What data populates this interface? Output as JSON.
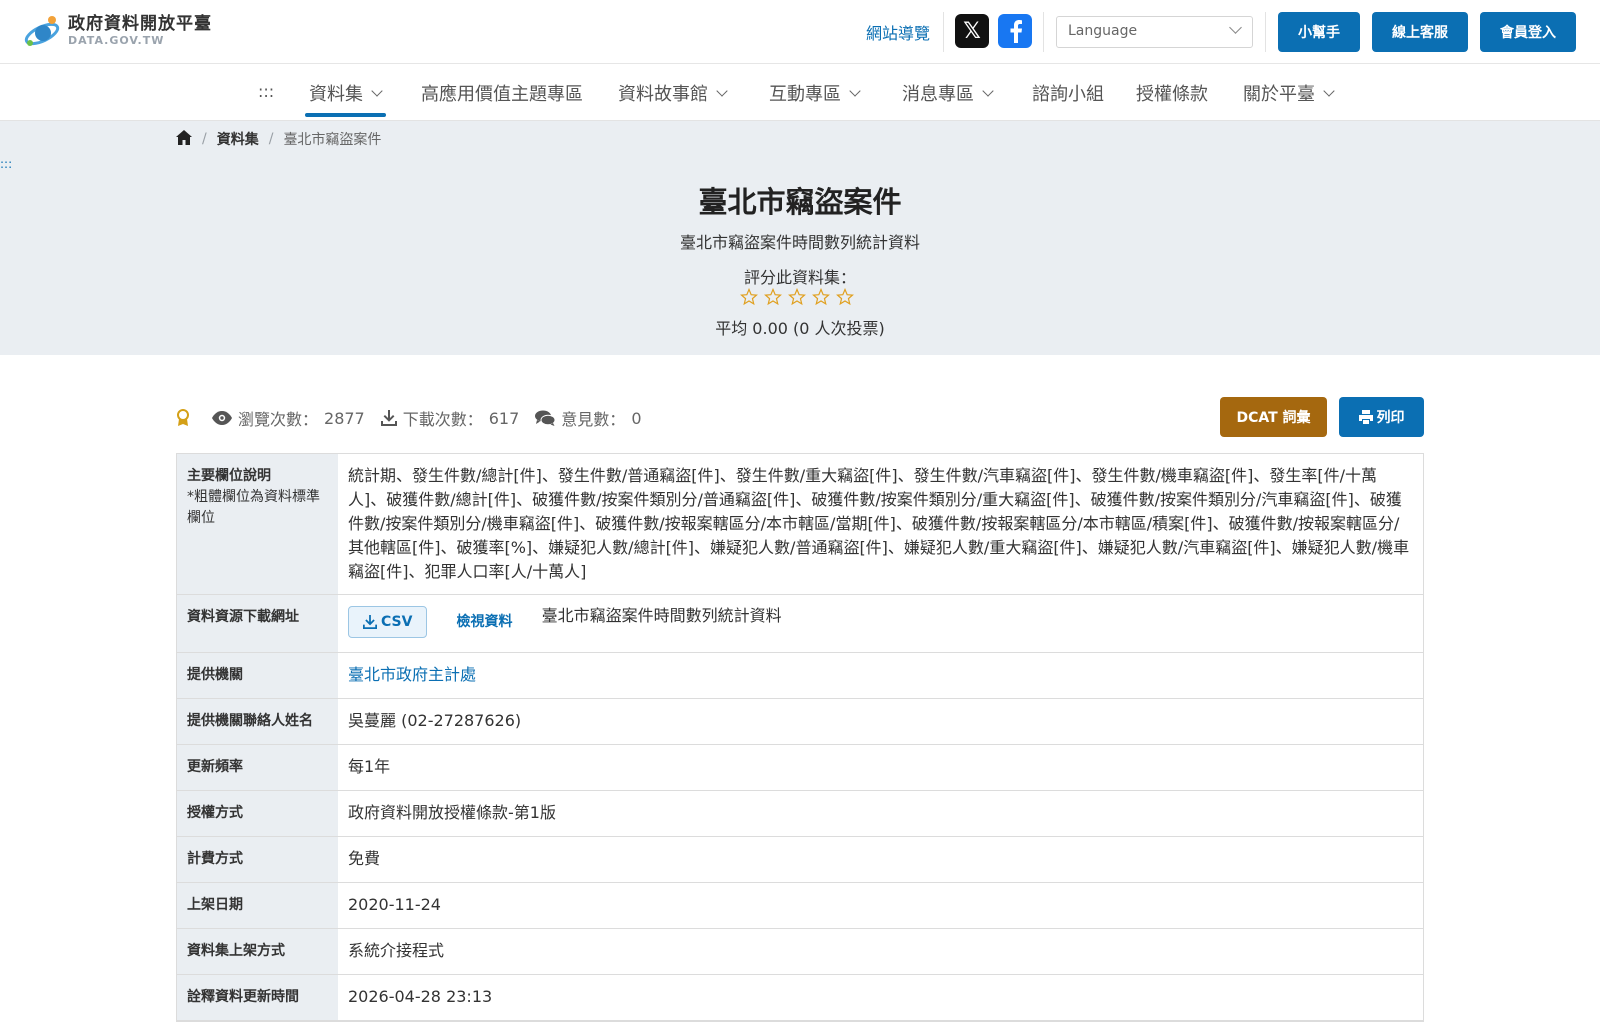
{
  "header": {
    "logo_title": "政府資料開放平臺",
    "logo_sub": "DATA.GOV.TW",
    "sitemap": "網站導覽",
    "language_placeholder": "Language",
    "buttons": {
      "helper": "小幫手",
      "service": "線上客服",
      "login": "會員登入"
    }
  },
  "nav": {
    "dots": ":::",
    "items": [
      {
        "label": "資料集",
        "dropdown": true,
        "active": true
      },
      {
        "label": "高應用價值主題專區",
        "dropdown": false
      },
      {
        "label": "資料故事館",
        "dropdown": true
      },
      {
        "label": "互動專區",
        "dropdown": true
      },
      {
        "label": "消息專區",
        "dropdown": true
      },
      {
        "label": "諮詢小組",
        "dropdown": false
      },
      {
        "label": "授權條款",
        "dropdown": false
      },
      {
        "label": "關於平臺",
        "dropdown": true
      }
    ]
  },
  "breadcrumb": {
    "sep": "/",
    "section": "資料集",
    "current": "臺北市竊盜案件"
  },
  "hero": {
    "dots": ":::",
    "title": "臺北市竊盜案件",
    "subtitle": "臺北市竊盜案件時間數列統計資料",
    "rate_label": "評分此資料集：",
    "rating": 0,
    "rating_max": 5,
    "rate_avg": "平均 0.00 (0 人次投票)"
  },
  "stats": {
    "views_label": "瀏覽次數：",
    "views": "2877",
    "downloads_label": "下載次數：",
    "downloads": "617",
    "comments_label": "意見數：",
    "comments": "0"
  },
  "actions": {
    "dcat": "DCAT 詞彙",
    "print": "列印"
  },
  "meta": {
    "main_fields_key": "主要欄位說明",
    "main_fields_note": "*粗體欄位為資料標準欄位",
    "main_fields": "統計期、發生件數/總計[件]、發生件數/普通竊盜[件]、發生件數/重大竊盜[件]、發生件數/汽車竊盜[件]、發生件數/機車竊盜[件]、發生率[件/十萬人]、破獲件數/總計[件]、破獲件數/按案件類別分/普通竊盜[件]、破獲件數/按案件類別分/重大竊盜[件]、破獲件數/按案件類別分/汽車竊盜[件]、破獲件數/按案件類別分/機車竊盜[件]、破獲件數/按報案轄區分/本市轄區/當期[件]、破獲件數/按報案轄區分/本市轄區/積案[件]、破獲件數/按報案轄區分/其他轄區[件]、破獲率[%]、嫌疑犯人數/總計[件]、嫌疑犯人數/普通竊盜[件]、嫌疑犯人數/重大竊盜[件]、嫌疑犯人數/汽車竊盜[件]、嫌疑犯人數/機車竊盜[件]、犯罪人口率[人/十萬人]",
    "download_key": "資料資源下載網址",
    "csv_label": "CSV",
    "view_label": "檢視資料",
    "resource_name": "臺北市竊盜案件時間數列統計資料",
    "agency_key": "提供機關",
    "agency": "臺北市政府主計處",
    "contact_key": "提供機關聯絡人姓名",
    "contact": "吳蔓麗 (02-27287626)",
    "freq_key": "更新頻率",
    "freq": "每1年",
    "license_key": "授權方式",
    "license": "政府資料開放授權條款-第1版",
    "fee_key": "計費方式",
    "fee": "免費",
    "date_key": "上架日期",
    "date": "2020-11-24",
    "method_key": "資料集上架方式",
    "method": "系統介接程式",
    "meta_update_key": "詮釋資料更新時間",
    "meta_update": "2026-04-28 23:13"
  },
  "colors": {
    "primary": "#0b6fb3",
    "dcat": "#a5680f",
    "hero_bg": "#eaeef2",
    "star": "#e0a020"
  }
}
